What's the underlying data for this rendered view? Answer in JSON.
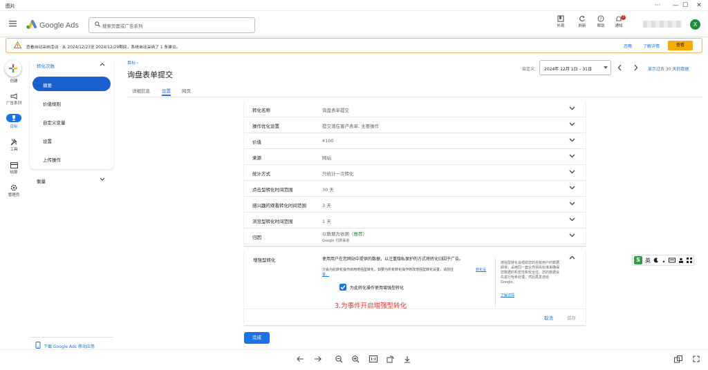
{
  "window": {
    "title": "图片"
  },
  "ads_header": {
    "product": "Google Ads",
    "search_placeholder": "搜索页面或广告系列",
    "tools": [
      {
        "label": "外观",
        "icon": "appearance-icon"
      },
      {
        "label": "刷新",
        "icon": "refresh-icon"
      },
      {
        "label": "帮助",
        "icon": "help-icon"
      },
      {
        "label": "通知",
        "icon": "bell-icon"
      }
    ],
    "notification_badge": "!",
    "avatar_letter": "X"
  },
  "banner": {
    "text": "查看自动采纳活动 · 从 2024/12/23至 2024/12/29期间，系统自动采纳了 1 条建议。",
    "ignore": "忽略",
    "learn_more": "了解详情",
    "view": "查看"
  },
  "rail": {
    "create": "创建",
    "campaigns": "广告系列",
    "goals": "目标",
    "tools": "工具",
    "billing": "结算",
    "admin": "管理员"
  },
  "sidenav": {
    "section": "转化次数",
    "items": [
      "摘要",
      "价值规则",
      "自定义变量",
      "设置",
      "上传操作"
    ],
    "measure": "衡量",
    "download": "下载 Google Ads 移动应用"
  },
  "main": {
    "breadcrumb": "目标 ›",
    "title": "询盘表单提交",
    "tabs": [
      "详细信息",
      "设置",
      "网页"
    ],
    "date_label": "自定义",
    "date_range": "2024年 12月 1日 – 31日",
    "compare": "显示过去 30 天的数据"
  },
  "settings": [
    {
      "label": "转化名称",
      "value": "询盘表单提交"
    },
    {
      "label": "操作优化设置",
      "value": "提交潜在客户表单, 主要操作"
    },
    {
      "label": "价值",
      "value": "¥100"
    },
    {
      "label": "来源",
      "value": "网站"
    },
    {
      "label": "统计方式",
      "value": "只统计一次转化"
    },
    {
      "label": "点击型转化时间范围",
      "value": "30 天"
    },
    {
      "label": "感兴趣的观看转化时间范围",
      "value": "3 天"
    },
    {
      "label": "浏览型转化时间范围",
      "value": "1 天"
    },
    {
      "label": "归因",
      "value": "以数据为依据（",
      "value_tag": "推荐",
      "value_end": "）",
      "sub": "Google 付费渠道"
    }
  ],
  "enhanced": {
    "label": "增强型转化",
    "desc": "使用用户在您网站中提供的数据，以注重隐私保护的方式将转化归因于广告。",
    "desc2": "只会为此转化操作启用增强型转化。如要为所有转化操作修改增强型转化设置，请前往",
    "desc2_link": "转化设",
    "desc2_link2": "置。",
    "checkbox_label": "为此转化操作使用增强型转化",
    "side_text": "增强型转化会借助您的自有用户的数据即将，采用同一套业界领先标准来确保您数据的机密性和安全性。您的数据会先进行哈希处理，然后再发送给 Google。",
    "side_link": "了解详情",
    "annotation": "3.为事件开启增强型转化",
    "cancel": "取消",
    "save": "保存"
  },
  "done": "完成",
  "ime": {
    "logo": "S",
    "lang": "英"
  }
}
